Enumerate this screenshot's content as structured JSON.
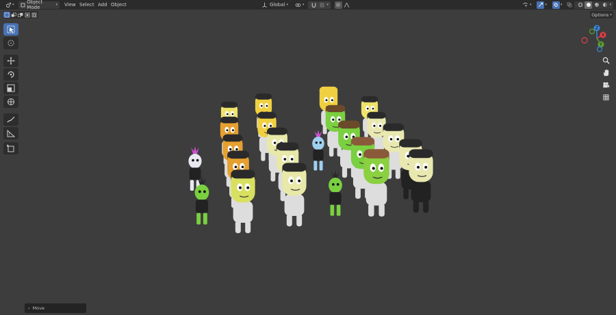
{
  "header": {
    "mode_label": "Object Mode",
    "menus": [
      "View",
      "Select",
      "Add",
      "Object"
    ],
    "transform_orientation": "Global"
  },
  "options_label": "Options",
  "last_operator": "Move",
  "gizmo": {
    "axis_x_label": "X",
    "axis_y_label": "Y",
    "axis_z_label": "Z",
    "colors": {
      "x": "#e0414d",
      "y": "#5fa034",
      "z": "#3b86d8"
    }
  },
  "colors": {
    "accent": "#4772b3",
    "viewport_bg": "#3d3d3d",
    "header_bg": "#2b2b2b"
  }
}
